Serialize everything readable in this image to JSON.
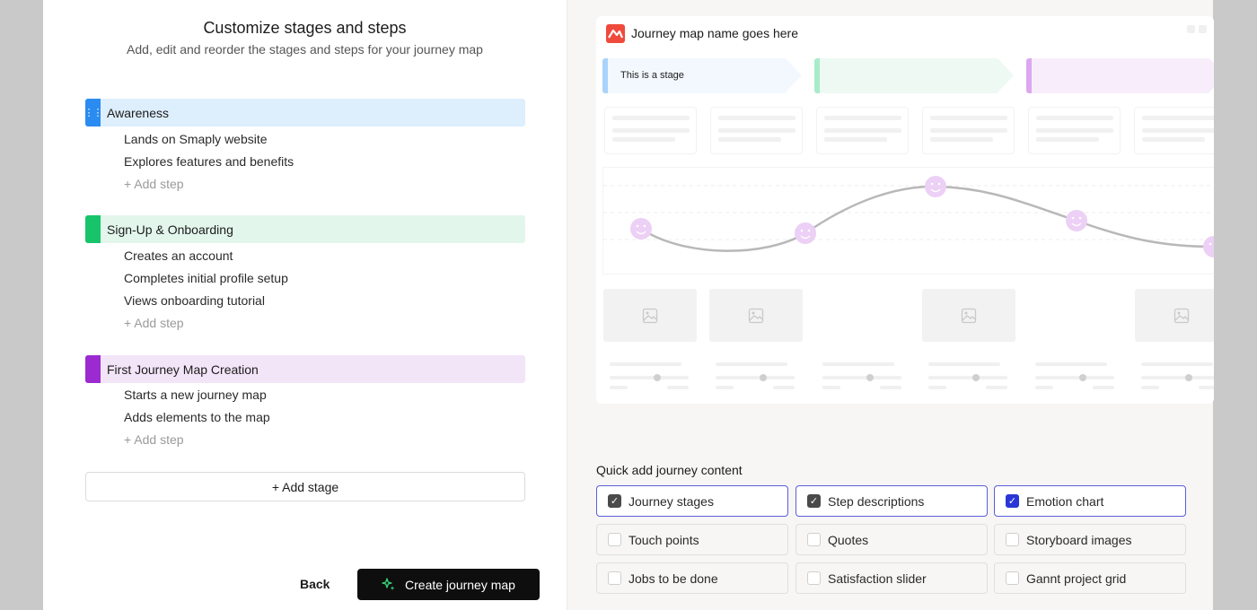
{
  "left": {
    "title": "Customize stages and steps",
    "subtitle": "Add, edit and reorder the stages and steps for your journey map",
    "stages": [
      {
        "name": "Awareness",
        "color": "#2a8cf0",
        "bg": "#ddeefd",
        "steps": [
          "Lands on Smaply website",
          "Explores features and benefits"
        ]
      },
      {
        "name": "Sign-Up & Onboarding",
        "color": "#18c46b",
        "bg": "#e2f6ec",
        "steps": [
          "Creates an account",
          "Completes initial profile setup",
          "Views onboarding tutorial"
        ]
      },
      {
        "name": "First Journey Map Creation",
        "color": "#9b2bd1",
        "bg": "#f3e5f8",
        "steps": [
          "Starts a new journey map",
          "Adds elements to the map"
        ]
      }
    ],
    "add_step_label": "+ Add step",
    "add_stage_label": "+ Add stage",
    "back_label": "Back",
    "create_label": "Create journey map"
  },
  "preview": {
    "title": "Journey map name goes here",
    "stage_label": "This is a stage",
    "stage_colors": [
      "#a9d3fb",
      "#a9ecca",
      "#dba7ef"
    ],
    "stage_bgs": [
      "#f3f8fe",
      "#eef9f3",
      "#f8eefb"
    ]
  },
  "quick_add": {
    "title": "Quick add journey content",
    "options": [
      {
        "label": "Journey stages",
        "checked": true,
        "style": "dark"
      },
      {
        "label": "Step descriptions",
        "checked": true,
        "style": "dark"
      },
      {
        "label": "Emotion chart",
        "checked": true,
        "style": "blue"
      },
      {
        "label": "Touch points",
        "checked": false
      },
      {
        "label": "Quotes",
        "checked": false
      },
      {
        "label": "Storyboard images",
        "checked": false
      },
      {
        "label": "Jobs to be done",
        "checked": false
      },
      {
        "label": "Satisfaction slider",
        "checked": false
      },
      {
        "label": "Gannt project grid",
        "checked": false
      }
    ]
  }
}
